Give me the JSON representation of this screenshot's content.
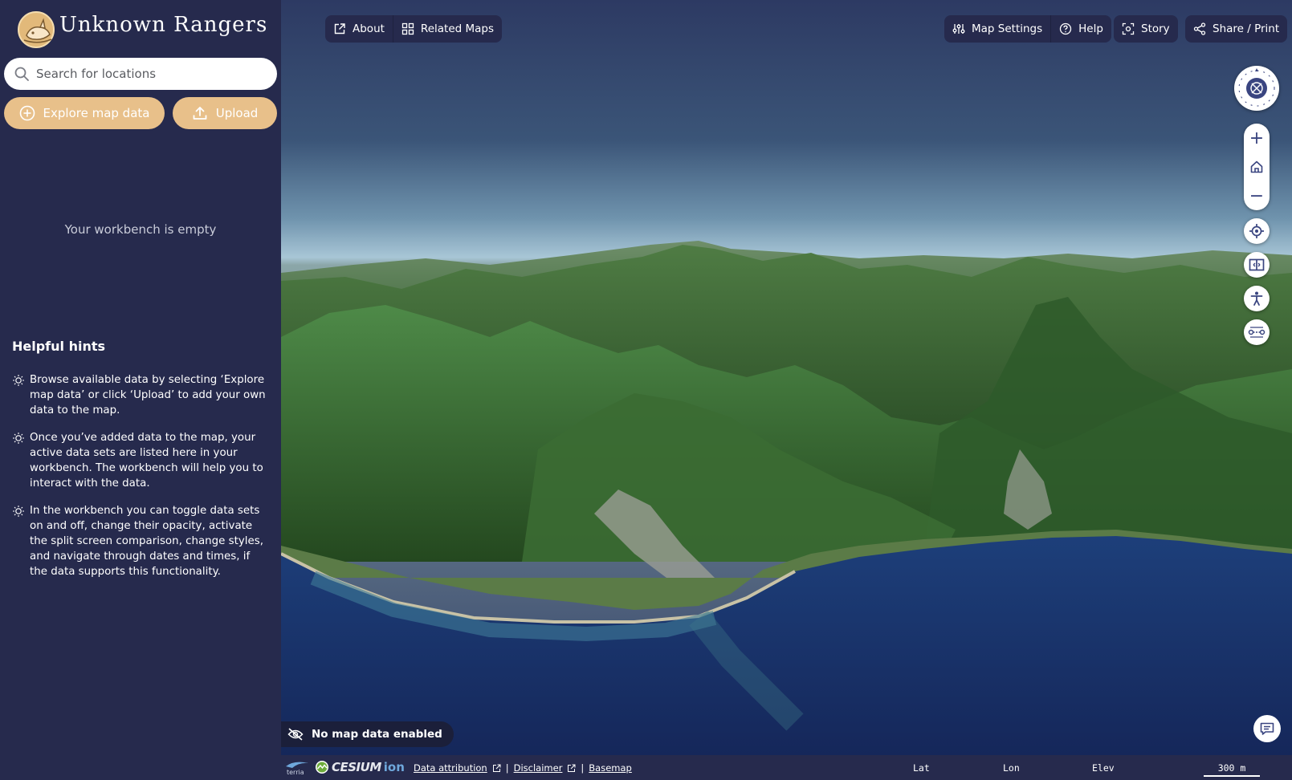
{
  "brand": {
    "title": "Unknown Rangers",
    "close_glyph": "✕"
  },
  "search": {
    "placeholder": "Search for locations",
    "value": ""
  },
  "actions": {
    "explore_label": "Explore map data",
    "upload_label": "Upload"
  },
  "workbench": {
    "empty_text": "Your workbench is empty"
  },
  "hints": {
    "title": "Helpful hints",
    "items": [
      "Browse available data by selecting ‘Explore map data’ or click ‘Upload’ to add your own data to the map.",
      "Once you’ve added data to the map, your active data sets are listed here in your workbench. The workbench will help you to interact with the data.",
      "In the workbench you can toggle data sets on and off, change their opacity, activate the split screen comparison, change styles, and navigate through dates and times, if the data supports this functionality."
    ]
  },
  "toolbar": {
    "about": "About",
    "related_maps": "Related Maps",
    "map_settings": "Map Settings",
    "help": "Help",
    "story": "Story",
    "share_print": "Share / Print"
  },
  "map_controls": {
    "zoom_in": "+",
    "zoom_out": "−",
    "icons": [
      "compass-icon",
      "home-icon",
      "locate-icon",
      "split-screen-icon",
      "accessibility-icon",
      "measure-icon"
    ]
  },
  "status": {
    "no_data": "No map data enabled"
  },
  "bottom_bar": {
    "terria_text": "terria",
    "cesium_text": "CESIUM",
    "ion_text": "ion",
    "data_attribution": "Data attribution",
    "disclaimer": "Disclaimer",
    "basemap": "Basemap",
    "separator": "|",
    "lat_label": "Lat",
    "lon_label": "Lon",
    "elev_label": "Elev",
    "scale_text": "300 m"
  },
  "colors": {
    "sidebar_bg": "#262a4d",
    "accent_button": "#e8c08a",
    "toolbar_bg": "#262a4d",
    "control_icon": "#3a4580"
  }
}
